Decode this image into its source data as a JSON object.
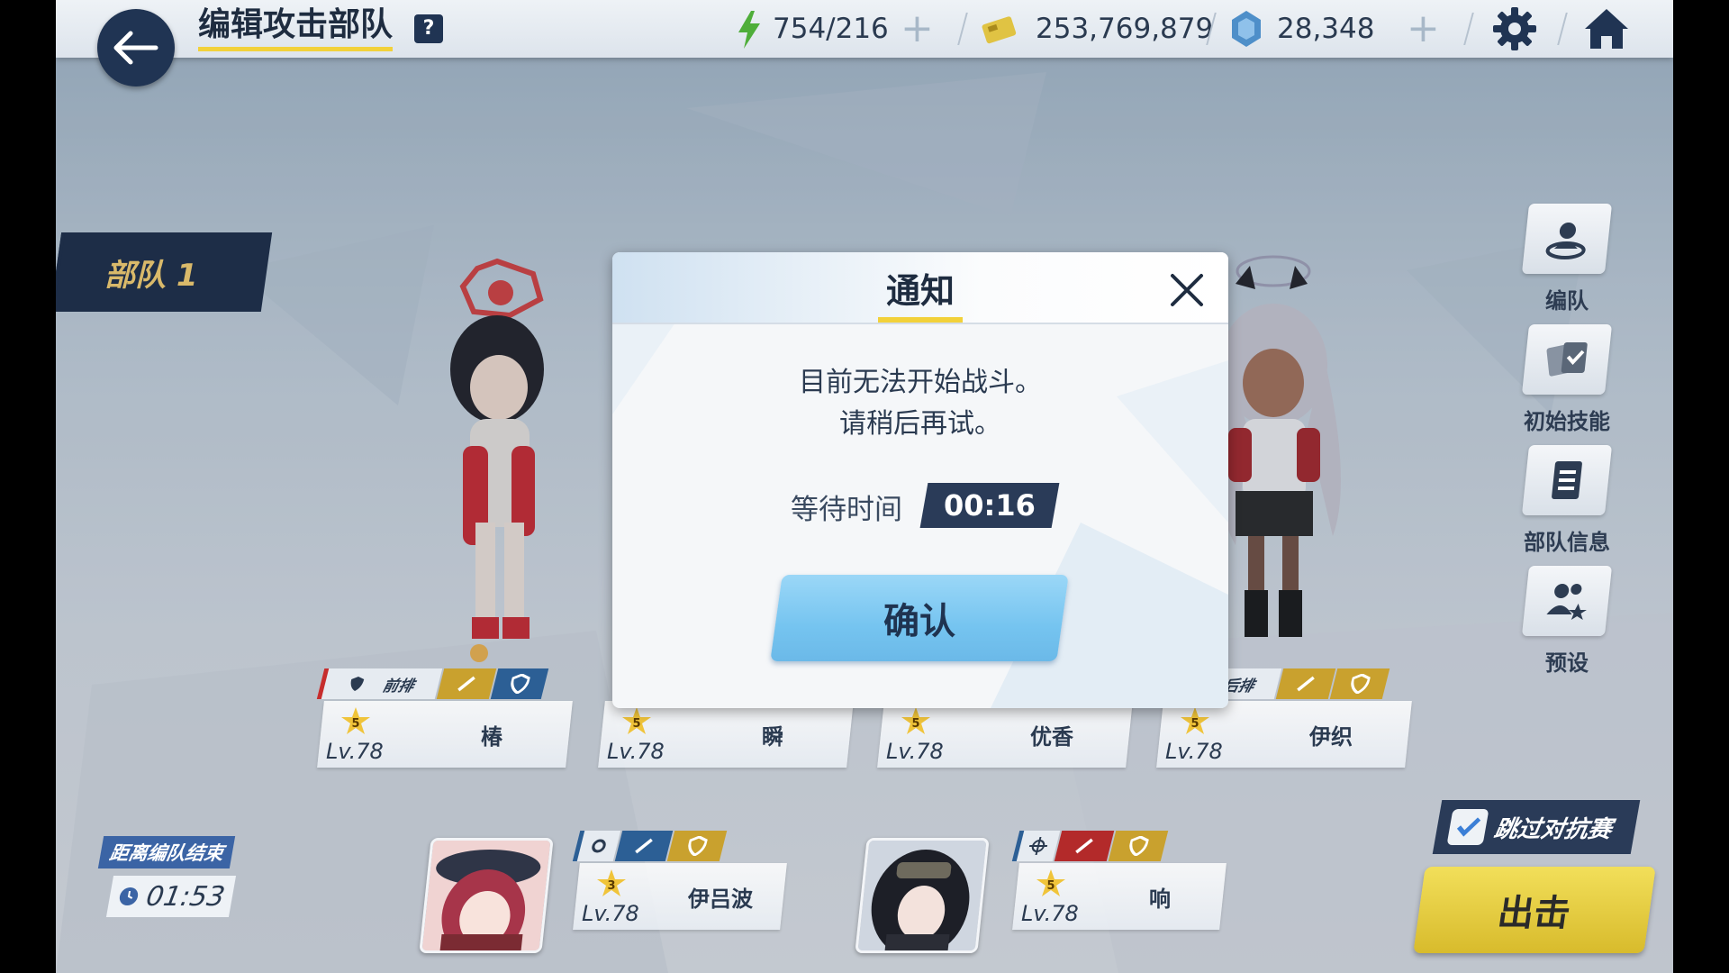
{
  "header": {
    "title": "编辑攻击部队",
    "help_label": "?",
    "ap": "754/216",
    "credits": "253,769,879",
    "gems": "28,348"
  },
  "squad": {
    "label": "部队 1"
  },
  "right_menu": [
    {
      "label": "编队"
    },
    {
      "label": "初始技能"
    },
    {
      "label": "部队信息"
    },
    {
      "label": "预设"
    }
  ],
  "front_row": [
    {
      "role": "前排",
      "stars": "5",
      "level": "Lv.78",
      "name": "椿"
    },
    {
      "stars": "5",
      "level": "Lv.78",
      "name": "瞬"
    },
    {
      "stars": "5",
      "level": "Lv.78",
      "name": "优香"
    },
    {
      "role": "后排",
      "stars": "5",
      "level": "Lv.78",
      "name": "伊织"
    }
  ],
  "support_row": [
    {
      "stars": "3",
      "level": "Lv.78",
      "name": "伊吕波"
    },
    {
      "stars": "5",
      "level": "Lv.78",
      "name": "响"
    }
  ],
  "timer": {
    "label": "距离编队结束",
    "value": "01:53"
  },
  "skip_battle": {
    "label": "跳过对抗赛",
    "checked": true
  },
  "sortie_label": "出击",
  "modal": {
    "title": "通知",
    "message_line1": "目前无法开始战斗。",
    "message_line2": "请稍后再试。",
    "wait_label": "等待时间",
    "wait_value": "00:16",
    "confirm_label": "确认"
  },
  "colors": {
    "navy": "#203453",
    "accent_yellow": "#f2d13a",
    "confirm_blue": "#75c4f0",
    "sortie_yellow": "#e6cc40"
  }
}
